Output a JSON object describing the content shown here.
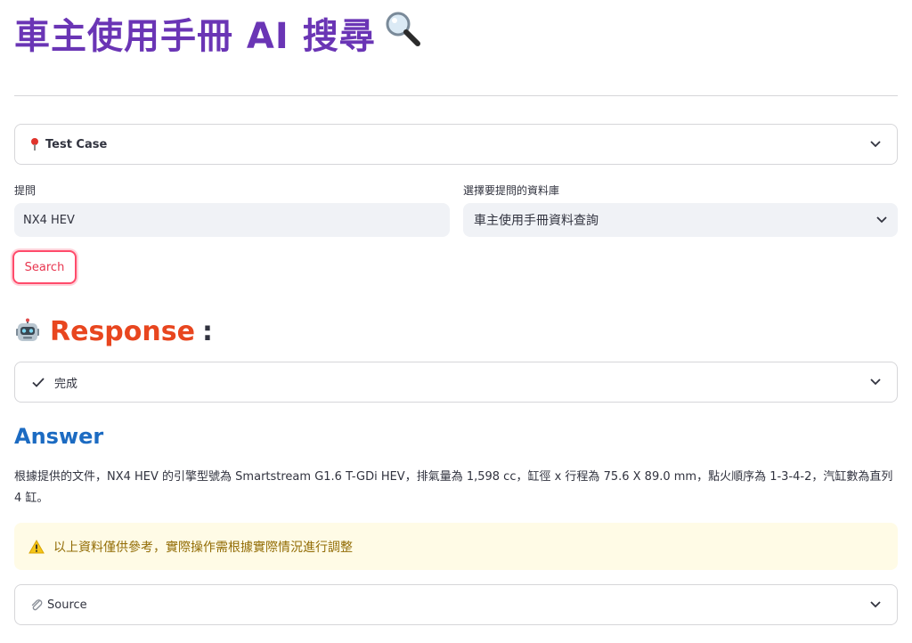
{
  "page": {
    "title": "車主使用手冊 AI 搜尋",
    "title_icon": "magnifier-icon"
  },
  "test_case": {
    "label": "Test Case",
    "icon": "pin-icon"
  },
  "question": {
    "label": "提問",
    "value": "NX4 HEV"
  },
  "database": {
    "label": "選擇要提問的資料庫",
    "selected": "車主使用手冊資料查詢"
  },
  "search_button": {
    "label": "Search"
  },
  "response": {
    "heading": "Response",
    "colon": ":",
    "icon": "robot-icon",
    "status": "完成",
    "status_icon": "check-icon"
  },
  "answer": {
    "heading": "Answer",
    "text": "根據提供的文件，NX4 HEV 的引擎型號為 Smartstream G1.6 T-GDi HEV，排氣量為 1,598 cc，缸徑 x 行程為 75.6 X 89.0 mm，點火順序為 1-3-4-2，汽缸數為直列 4 缸。"
  },
  "warning": {
    "text": "以上資料僅供參考，實際操作需根據實際情況進行調整",
    "icon": "warning-icon"
  },
  "source": {
    "label": "Source",
    "icon": "paperclip-icon"
  },
  "colors": {
    "title": "#6a35b5",
    "response": "#e8461f",
    "answer": "#1c6bc2",
    "button_border": "#ff4b6b",
    "warning_bg": "#fffbe6",
    "warning_text": "#926c05"
  }
}
